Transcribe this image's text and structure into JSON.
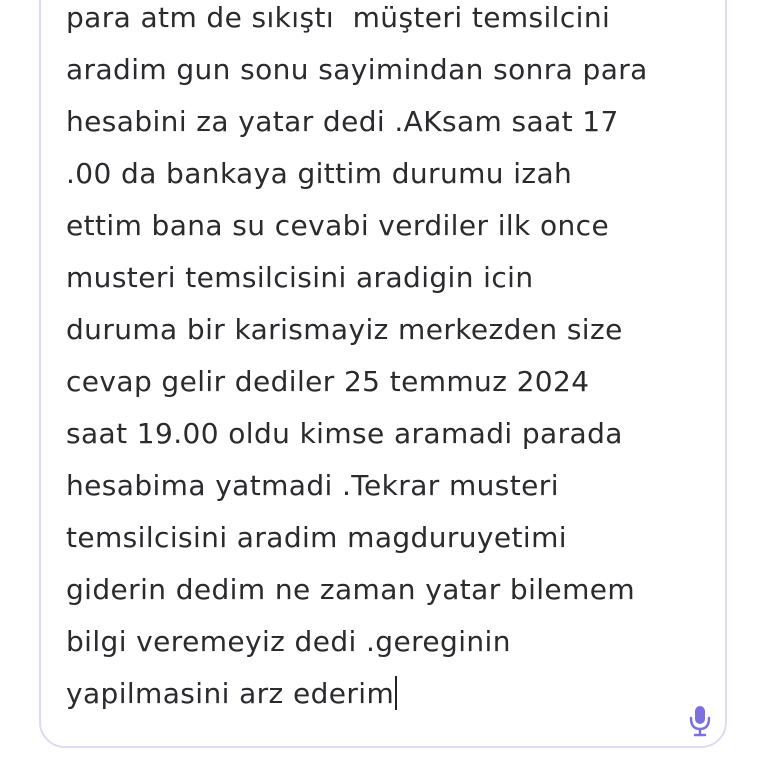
{
  "complaint_field": {
    "lines": [
      "para atm de sıkıştı  müşteri temsilcini",
      "aradim gun sonu sayimindan sonra para",
      "hesabini za yatar dedi .AKsam saat 17",
      ".00 da bankaya gittim durumu izah",
      "ettim bana su cevabi verdiler ilk once",
      "musteri temsilcisini aradigin icin",
      "duruma bir karismayiz merkezden size",
      "cevap gelir dediler 25 temmuz 2024",
      "saat 19.00 oldu kimse aramadi parada",
      "hesabima yatmadi .Tekrar musteri",
      "temsilcisini aradim magduruyetimi",
      "giderin dedim ne zaman yatar bilemem",
      "bilgi veremeyiz dedi .gereginin",
      "yapilmasini arz ederim"
    ]
  },
  "icons": {
    "mic": "microphone-icon"
  },
  "colors": {
    "border": "#d9dcf3",
    "text": "#2b2b2f",
    "mic": "#7b72e0"
  }
}
